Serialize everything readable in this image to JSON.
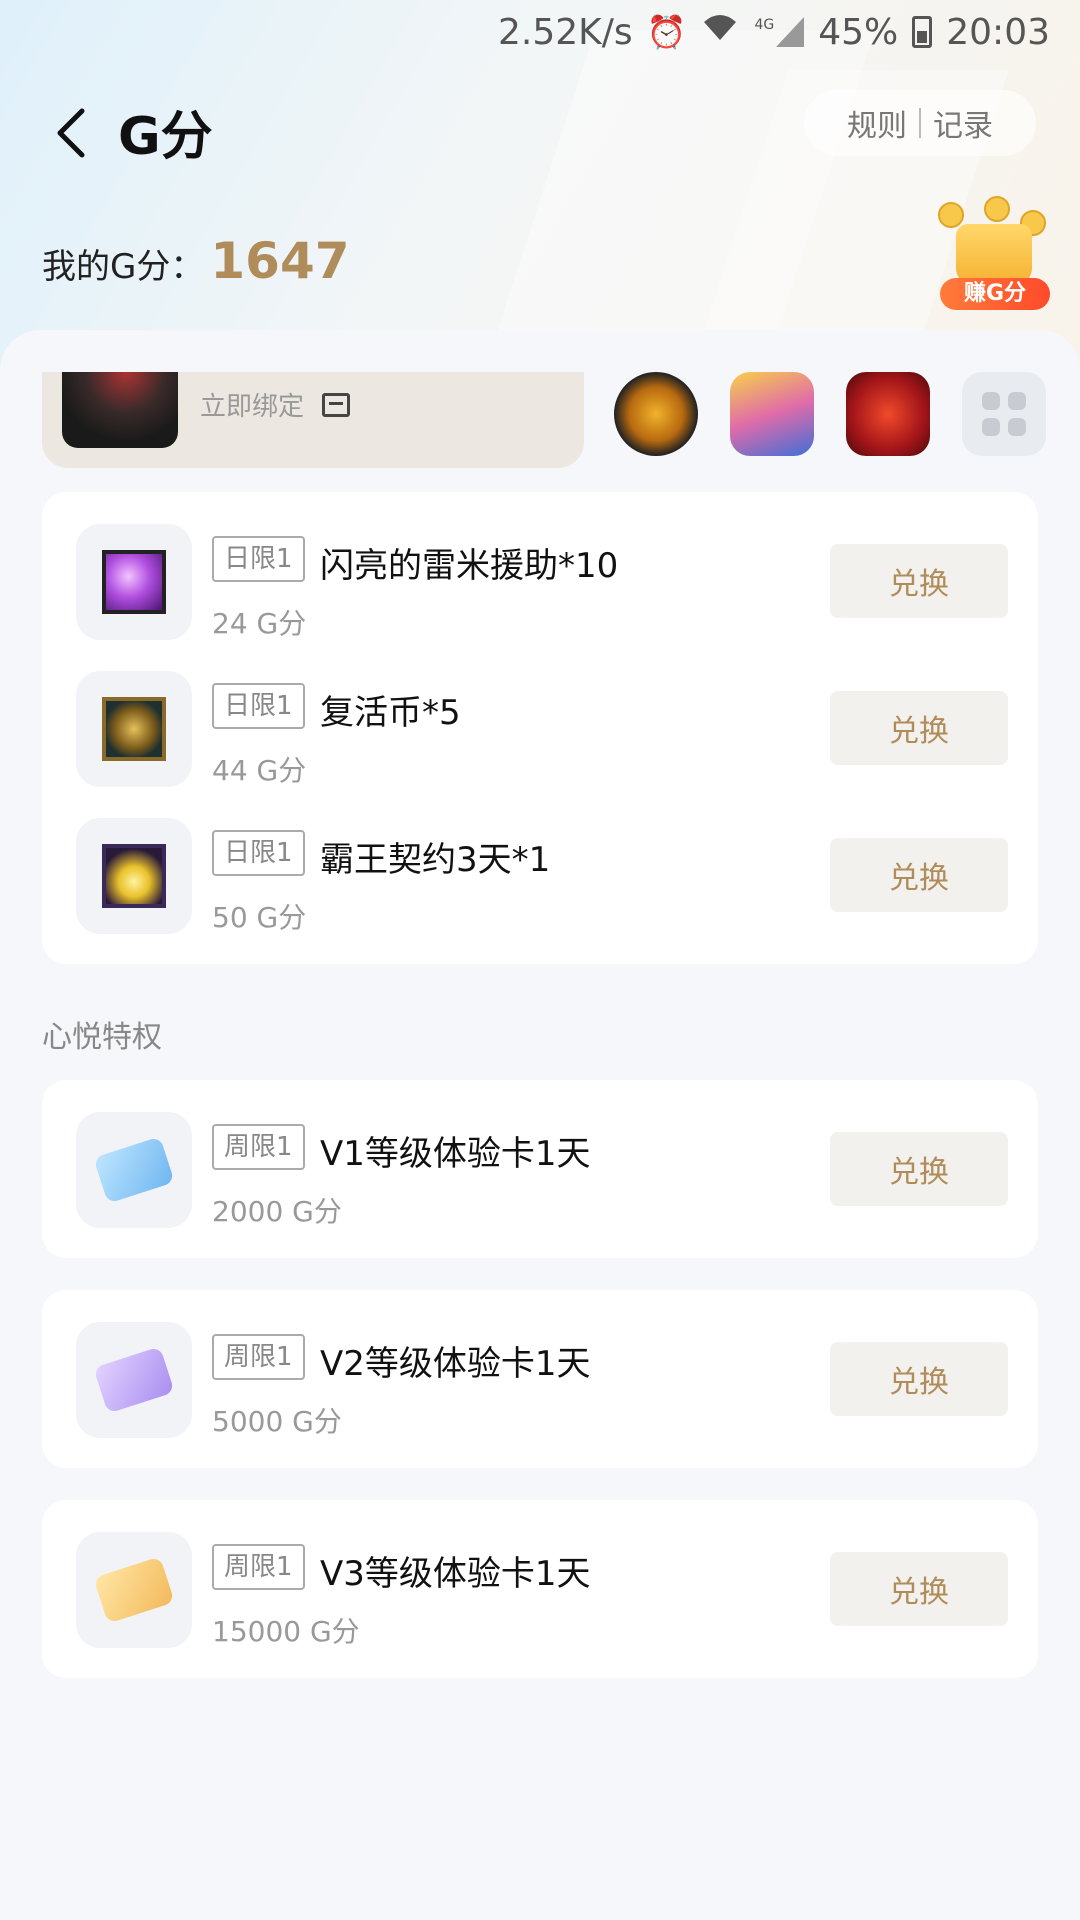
{
  "status_bar": {
    "speed": "2.52K/s",
    "network": "4G",
    "battery": "45%",
    "time": "20:03"
  },
  "header": {
    "title": "G分",
    "rules_link": "规则",
    "records_link": "记录"
  },
  "score": {
    "label": "我的G分：",
    "value": "1647",
    "earn_label": "赚G分"
  },
  "bind": {
    "action_label": "立即绑定"
  },
  "daily_items": [
    {
      "limit": "日限1",
      "name": "闪亮的雷米援助*10",
      "cost": "24 G分",
      "button": "兑换"
    },
    {
      "limit": "日限1",
      "name": "复活币*5",
      "cost": "44 G分",
      "button": "兑换"
    },
    {
      "limit": "日限1",
      "name": "霸王契约3天*1",
      "cost": "50 G分",
      "button": "兑换"
    }
  ],
  "privilege_section": {
    "title": "心悦特权"
  },
  "privilege_items": [
    {
      "limit": "周限1",
      "name": "V1等级体验卡1天",
      "cost": "2000 G分",
      "button": "兑换"
    },
    {
      "limit": "周限1",
      "name": "V2等级体验卡1天",
      "cost": "5000 G分",
      "button": "兑换"
    },
    {
      "limit": "周限1",
      "name": "V3等级体验卡1天",
      "cost": "15000 G分",
      "button": "兑换"
    }
  ],
  "icons": {
    "back": "back-arrow-icon",
    "alarm": "alarm-icon",
    "wifi": "wifi-icon",
    "signal": "signal-icon",
    "battery": "battery-icon",
    "card": "card-icon",
    "more": "more-apps-icon"
  },
  "colors": {
    "accent_gold": "#b08c5a",
    "earn_orange": "#ff5a2a"
  }
}
